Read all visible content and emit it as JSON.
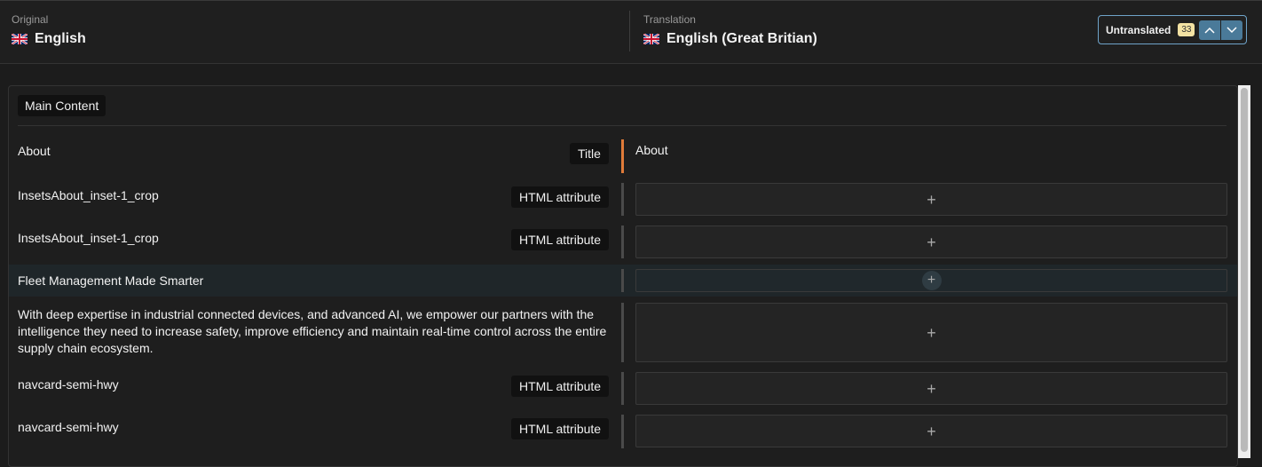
{
  "header": {
    "original_label": "Original",
    "original_language": "English",
    "translation_label": "Translation",
    "translation_language": "English (Great Britian)",
    "flag_icon": "uk-flag-icon",
    "filter": {
      "label": "Untranslated",
      "count": "33"
    }
  },
  "section": {
    "label": "Main Content"
  },
  "rows": [
    {
      "source": "About",
      "tag": "Title",
      "translation": "About"
    },
    {
      "source": "InsetsAbout_inset-1_crop",
      "tag": "HTML attribute",
      "translation": ""
    },
    {
      "source": "InsetsAbout_inset-1_crop",
      "tag": "HTML attribute",
      "translation": ""
    },
    {
      "source": "Fleet Management Made Smarter",
      "tag": "",
      "translation": ""
    },
    {
      "source": "With deep expertise in industrial connected devices, and advanced AI, we empower our partners with the intelligence they need to increase safety, improve efficiency and maintain real-time control across the entire supply chain ecosystem.",
      "tag": "",
      "translation": ""
    },
    {
      "source": "navcard-semi-hwy",
      "tag": "HTML attribute",
      "translation": ""
    },
    {
      "source": "navcard-semi-hwy",
      "tag": "HTML attribute",
      "translation": ""
    }
  ],
  "colors": {
    "accent": "#e07b39",
    "filter_border": "#6fa3c9",
    "nav_button": "#4a7a99"
  }
}
